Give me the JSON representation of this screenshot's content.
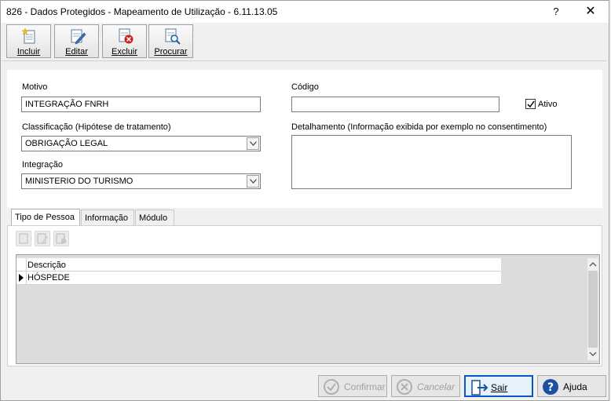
{
  "window": {
    "title": "826 - Dados Protegidos - Mapeamento de Utilização - 6.11.13.05",
    "help_glyph": "?",
    "close_glyph": "✕"
  },
  "toolbar": {
    "incluir": "Incluir",
    "editar": "Editar",
    "excluir": "Excluir",
    "procurar": "Procurar"
  },
  "form": {
    "motivo_label": "Motivo",
    "motivo_value": "INTEGRAÇÃO FNRH",
    "codigo_label": "Código",
    "codigo_value": "",
    "ativo_label": "Ativo",
    "ativo_checked": true,
    "classificacao_label": "Classificação (Hipótese de tratamento)",
    "classificacao_value": "OBRIGAÇÃO LEGAL",
    "detalhamento_label": "Detalhamento (Informação exibida por exemplo no consentimento)",
    "detalhamento_value": "",
    "integracao_label": "Integração",
    "integracao_value": "MINISTERIO DO TURISMO"
  },
  "tabs": [
    "Tipo de Pessoa",
    "Informação",
    "Módulo"
  ],
  "grid": {
    "columns": [
      "Descrição"
    ],
    "rows": [
      [
        "HÓSPEDE"
      ]
    ]
  },
  "footer": {
    "confirmar": "Confirmar",
    "cancelar": "Cancelar",
    "sair": "Sair",
    "ajuda": "Ajuda"
  },
  "colors": {
    "focus_border": "#0a56c8",
    "help_icon": "#1e4fa0"
  }
}
